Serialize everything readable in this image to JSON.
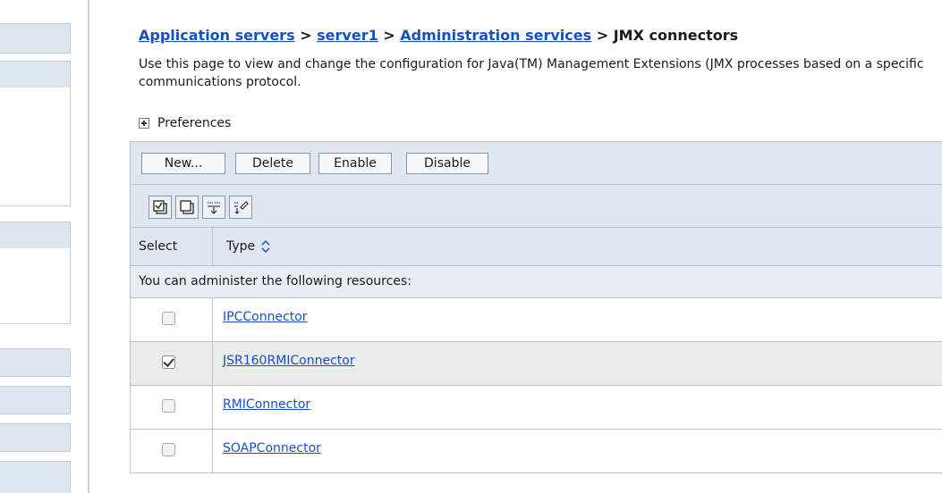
{
  "breadcrumb": {
    "items": [
      "Application servers",
      "server1",
      "Administration services"
    ],
    "separator": ">",
    "current": "JMX connectors"
  },
  "description": "Use this page to view and change the configuration for Java(TM) Management Extensions (JMX processes based on a specific communications protocol.",
  "preferences": {
    "label": "Preferences",
    "icon": "expand-plus-icon"
  },
  "toolbar": {
    "buttons": [
      "New...",
      "Delete",
      "Enable",
      "Disable"
    ],
    "icons": [
      "select-all-icon",
      "deselect-all-icon",
      "show-filter-icon",
      "clear-filter-icon"
    ]
  },
  "table": {
    "columns": [
      "Select",
      "Type"
    ],
    "sort_icon": "sort-toggle-icon",
    "notice": "You can administer the following resources:",
    "rows": [
      {
        "type": "IPCConnector",
        "checked": false
      },
      {
        "type": "JSR160RMIConnector",
        "checked": true
      },
      {
        "type": "RMIConnector",
        "checked": false
      },
      {
        "type": "SOAPConnector",
        "checked": false
      }
    ]
  },
  "colors": {
    "link": "#1a4fc4",
    "table_header_bg": "#dfe6ef",
    "selected_row_bg": "#ebebeb",
    "border": "#b6c2d2"
  }
}
